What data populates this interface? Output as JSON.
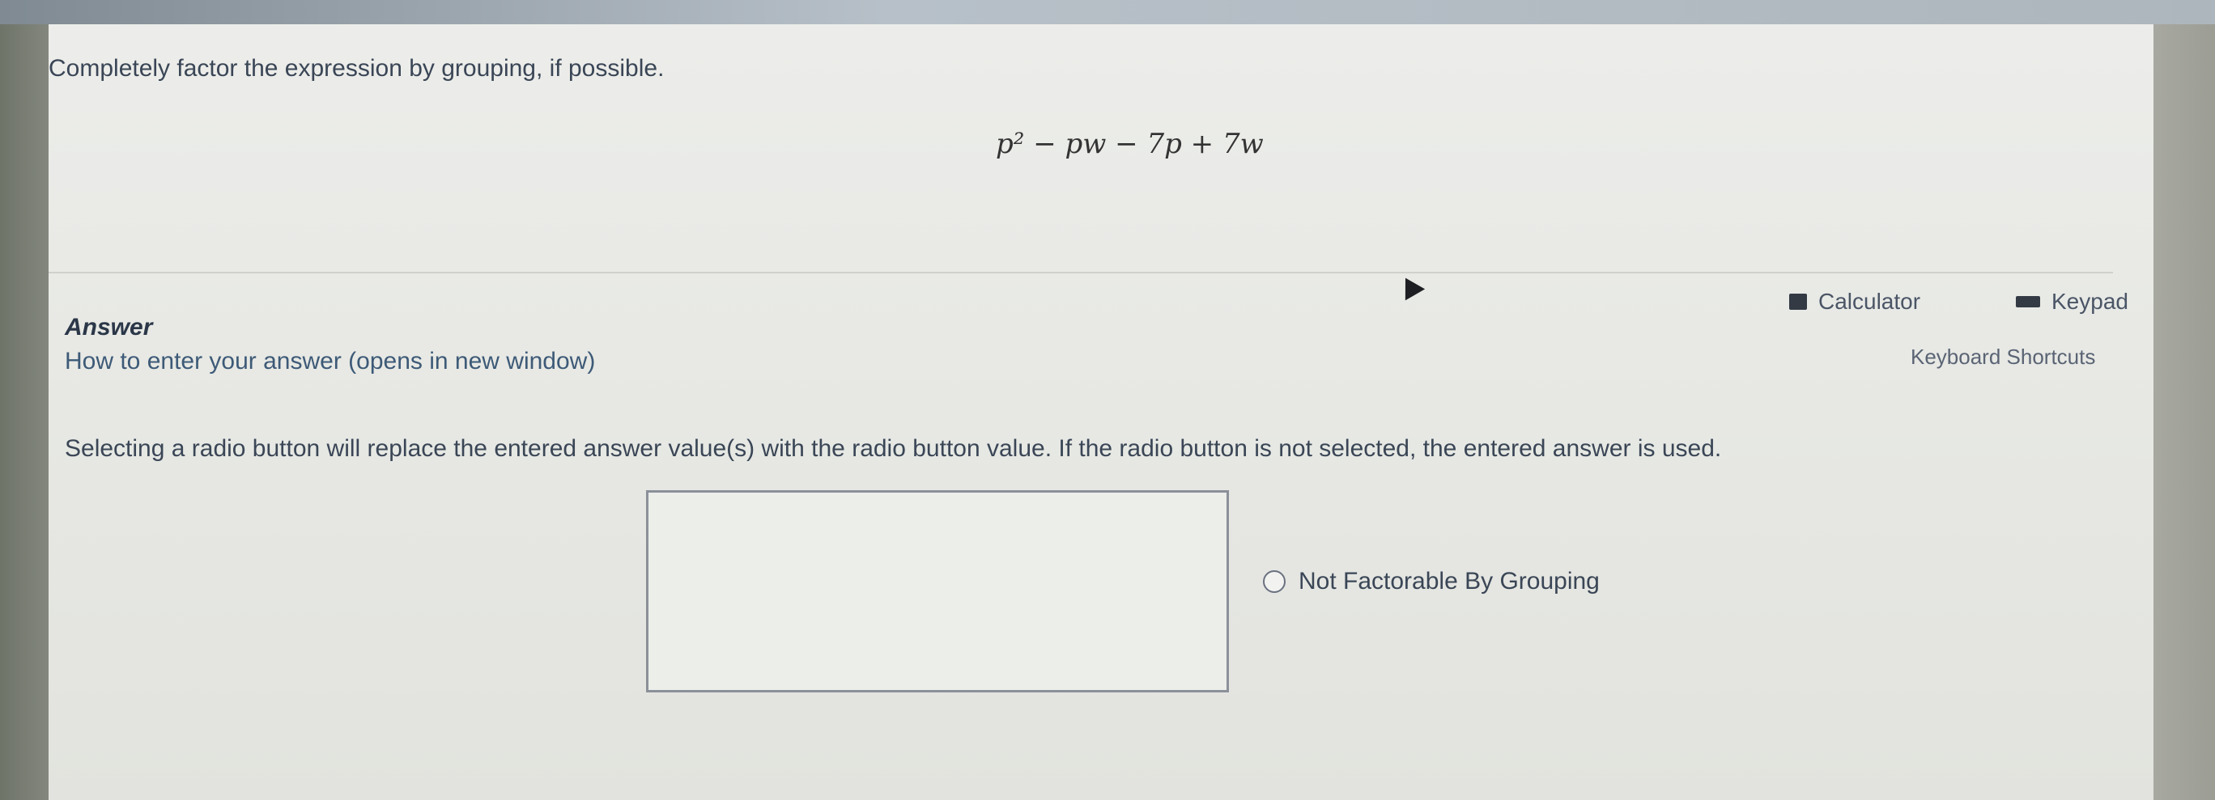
{
  "question": {
    "prompt": "Completely factor the expression by grouping, if possible.",
    "expression": "p² − pw − 7p + 7w"
  },
  "answer": {
    "label": "Answer",
    "help_link": "How to enter your answer (opens in new window)"
  },
  "tools": {
    "calculator_label": "Calculator",
    "keypad_label": "Keypad",
    "shortcuts_label": "Keyboard Shortcuts"
  },
  "instructions": "Selecting a radio button will replace the entered answer value(s) with the radio button value. If the radio button is not selected, the entered answer is used.",
  "answer_input": {
    "value": "",
    "placeholder": ""
  },
  "radio_option": {
    "label": "Not Factorable By Grouping"
  }
}
